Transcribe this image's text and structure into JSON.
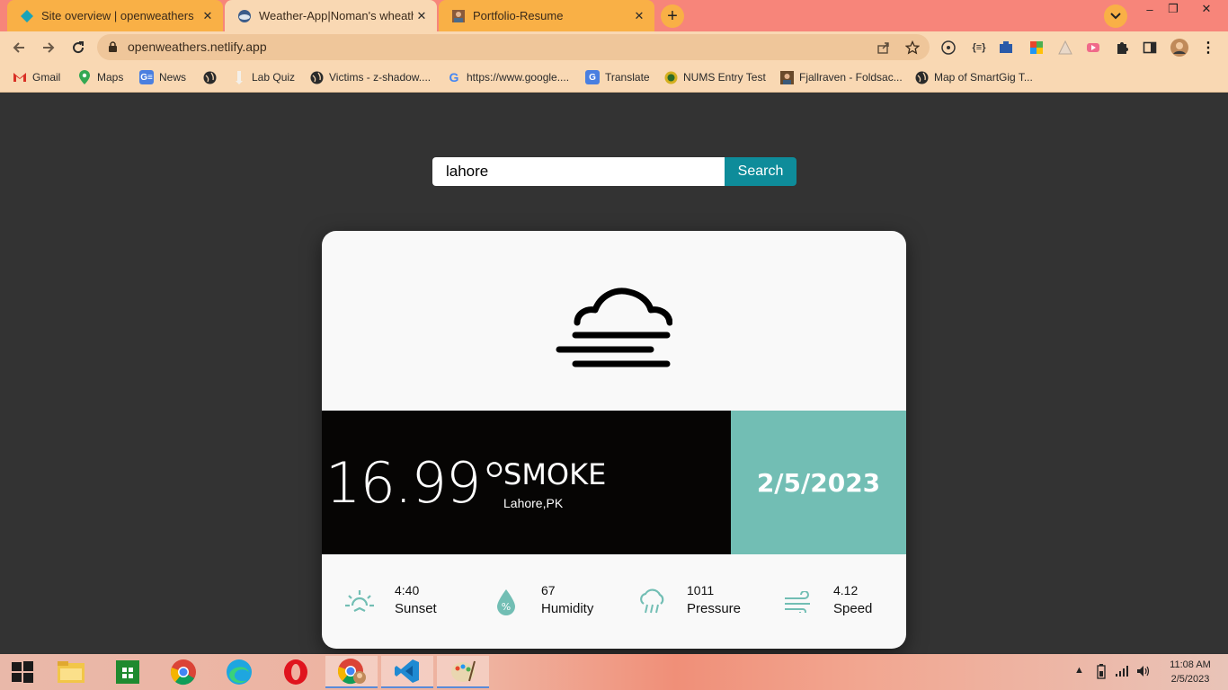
{
  "browser": {
    "tabs": [
      {
        "title": "Site overview | openweathers",
        "close": "✕"
      },
      {
        "title": "Weather-App|Noman's wheather",
        "close": "✕"
      },
      {
        "title": "Portfolio-Resume",
        "close": "✕"
      }
    ],
    "new_tab": "+",
    "url": "openweathers.netlify.app",
    "window_controls": {
      "minimize": "–",
      "restore": "❐",
      "close": "✕"
    }
  },
  "bookmarks": [
    {
      "label": "Gmail",
      "icon": "gmail-icon"
    },
    {
      "label": "Maps",
      "icon": "maps-icon"
    },
    {
      "label": "News",
      "icon": "news-icon"
    },
    {
      "label": "",
      "icon": "globe-icon"
    },
    {
      "label": "Lab Quiz",
      "icon": "quiz-icon"
    },
    {
      "label": "Victims - z-shadow....",
      "icon": "globe-icon"
    },
    {
      "label": "https://www.google....",
      "icon": "google-icon"
    },
    {
      "label": "Translate",
      "icon": "translate-icon"
    },
    {
      "label": "NUMS Entry Test",
      "icon": "nums-icon"
    },
    {
      "label": "Fjallraven - Foldsac...",
      "icon": "shop-icon"
    },
    {
      "label": "Map of SmartGig T...",
      "icon": "globe-icon"
    }
  ],
  "search": {
    "value": "lahore",
    "button_label": "Search"
  },
  "weather": {
    "temperature": "16.99°",
    "condition": "SMOKE",
    "location": "Lahore,PK",
    "date": "2/5/2023",
    "icon": "fog-icon",
    "stats": [
      {
        "value": "4:40",
        "label": "Sunset",
        "icon": "sunset-icon"
      },
      {
        "value": "67",
        "label": "Humidity",
        "icon": "humidity-icon"
      },
      {
        "value": "1011",
        "label": "Pressure",
        "icon": "pressure-icon"
      },
      {
        "value": "4.12",
        "label": "Speed",
        "icon": "wind-icon"
      }
    ]
  },
  "colors": {
    "accent_teal": "#72beb4",
    "search_button": "#0e8c9a",
    "dark_band": "#060504"
  },
  "taskbar": {
    "apps": [
      "file-explorer-icon",
      "store-icon",
      "chrome-icon",
      "edge-icon",
      "opera-icon",
      "chrome-profile-icon",
      "vscode-icon",
      "paint-icon"
    ],
    "clock_time": "11:08 AM",
    "clock_date": "2/5/2023"
  }
}
